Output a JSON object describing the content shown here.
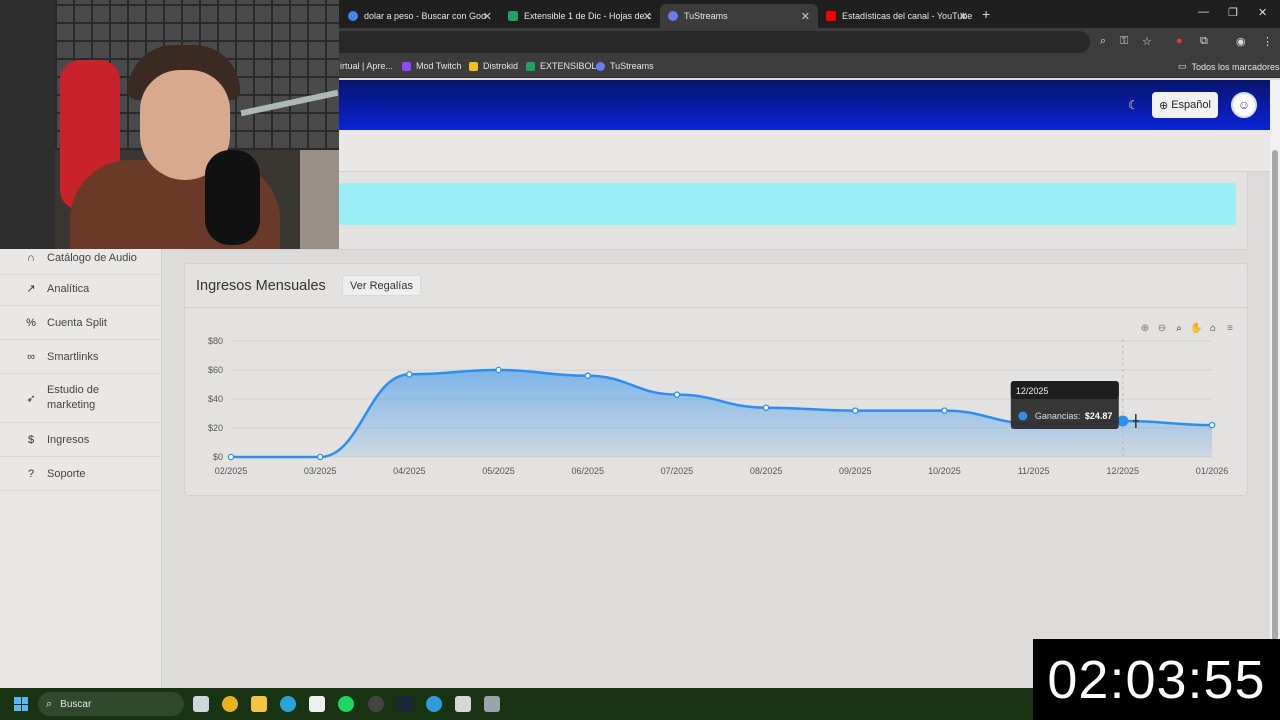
{
  "browser": {
    "tabs": [
      {
        "label": "dolar a peso - Buscar con Goo",
        "color": "#4285f4"
      },
      {
        "label": "Extensible 1 de Dic - Hojas de c",
        "color": "#1ea362"
      },
      {
        "label": "TuStreams",
        "color": "#6c7cf0"
      },
      {
        "label": "Estadísticas del canal - YouTube",
        "color": "#ff0000"
      }
    ],
    "bookmarks": [
      {
        "label": "irtual | Apre...",
        "color": "#888888"
      },
      {
        "label": "Mod Twitch",
        "color": "#9146ff"
      },
      {
        "label": "Distrokid",
        "color": "#f2c21b"
      },
      {
        "label": "EXTENSIBOL",
        "color": "#1ea362"
      },
      {
        "label": "TuStreams",
        "color": "#6c7cf0"
      }
    ],
    "all_bookmarks": "Todos los marcadores"
  },
  "header": {
    "language": "Español"
  },
  "sidebar": {
    "items": [
      {
        "label": "Catálogo de Audio",
        "icon": "headphones-icon",
        "glyph": "∩"
      },
      {
        "label": "Analítica",
        "icon": "chart-line-icon",
        "glyph": "↗"
      },
      {
        "label": "Cuenta Split",
        "icon": "percent-icon",
        "glyph": "%"
      },
      {
        "label": "Smartlinks",
        "icon": "link-icon",
        "glyph": "∞"
      },
      {
        "label": "Estudio de marketing",
        "icon": "rocket-icon",
        "glyph": "➶"
      },
      {
        "label": "Ingresos",
        "icon": "dollar-icon",
        "glyph": "$"
      },
      {
        "label": "Soporte",
        "icon": "question-icon",
        "glyph": "?"
      }
    ]
  },
  "card": {
    "title": "Ingresos Mensuales",
    "button": "Ver Regalías"
  },
  "chart_data": {
    "type": "area",
    "x": [
      "02/2025",
      "03/2025",
      "04/2025",
      "05/2025",
      "06/2025",
      "07/2025",
      "08/2025",
      "09/2025",
      "10/2025",
      "11/2025",
      "12/2025",
      "01/2026"
    ],
    "series": [
      {
        "name": "Ganancias",
        "values": [
          0,
          0,
          57,
          60,
          56,
          43,
          34,
          32,
          32,
          23,
          24.87,
          22
        ]
      }
    ],
    "y_ticks": [
      "$0",
      "$20",
      "$40",
      "$60",
      "$80"
    ],
    "ylim": [
      0,
      80
    ],
    "grid": true,
    "color": "#2b8ff0",
    "tooltip": {
      "title": "12/2025",
      "label": "Ganancias:",
      "value": "$24.87",
      "index": 10
    }
  },
  "taskbar": {
    "search": "Buscar"
  },
  "timer": "02:03:55"
}
